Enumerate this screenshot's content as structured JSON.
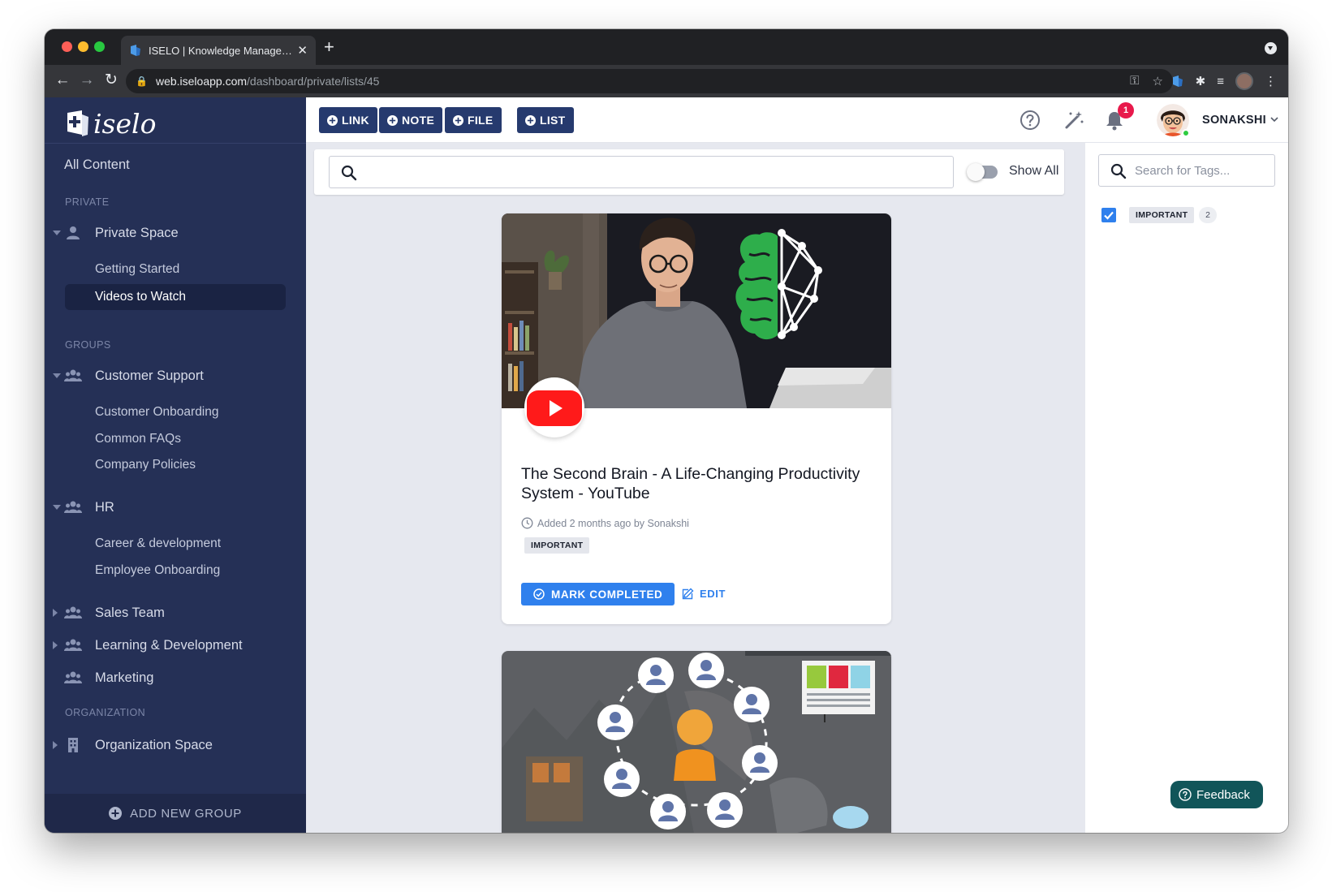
{
  "browser": {
    "tab_title": "ISELO | Knowledge Management",
    "url_host": "web.iseloapp.com",
    "url_path": "/dashboard/private/lists/45"
  },
  "sidebar": {
    "logo_text": "iselo",
    "all_content": "All Content",
    "private_label": "PRIVATE",
    "private_space": {
      "label": "Private Space",
      "children": [
        "Getting Started",
        "Videos to Watch"
      ],
      "active": "Videos to Watch"
    },
    "groups_label": "GROUPS",
    "groups": [
      {
        "label": "Customer Support",
        "expanded": true,
        "children": [
          "Customer Onboarding",
          "Common FAQs",
          "Company Policies"
        ]
      },
      {
        "label": "HR",
        "expanded": true,
        "children": [
          "Career & development",
          "Employee Onboarding"
        ]
      },
      {
        "label": "Sales Team",
        "expanded": false,
        "children": []
      },
      {
        "label": "Learning & Development",
        "expanded": false,
        "children": []
      },
      {
        "label": "Marketing",
        "expanded": false,
        "children": []
      }
    ],
    "organization_label": "ORGANIZATION",
    "organization_space": "Organization Space",
    "add_new_group": "ADD NEW GROUP"
  },
  "topbar": {
    "buttons": [
      "LINK",
      "NOTE",
      "FILE",
      "LIST"
    ],
    "notification_count": "1",
    "user_name": "SONAKSHI"
  },
  "search": {
    "placeholder": "",
    "toggle_label": "Show All",
    "toggle_on": false
  },
  "feed": {
    "cards": [
      {
        "title": "The Second Brain - A Life-Changing Productivity System - YouTube",
        "meta": "Added 2 months ago by Sonakshi",
        "tag": "IMPORTANT",
        "mark_completed": "MARK COMPLETED",
        "edit": "EDIT"
      }
    ]
  },
  "tags_panel": {
    "search_placeholder": "Search for Tags...",
    "tags": [
      {
        "name": "IMPORTANT",
        "count": "2",
        "checked": true
      }
    ]
  },
  "feedback": {
    "label": "Feedback"
  },
  "colors": {
    "sidebar_bg": "#253056",
    "primary_blue": "#2f80ed",
    "nav_button": "#263a6e",
    "feedback_bg": "#115559",
    "badge_red": "#e8194b"
  }
}
